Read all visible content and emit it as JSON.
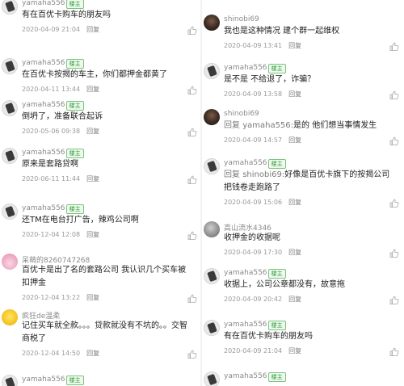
{
  "left": {
    "comments": [
      {
        "avatar": "yamaha",
        "name": "yamaha556",
        "badge": "楼主",
        "text": "有在百优卡购车的朋友吗",
        "time": "2020-04-09 21:04",
        "reply": "回复"
      },
      {
        "avatar": "yamaha",
        "name": "yamaha556",
        "badge": "楼主",
        "text": "在百优卡按揭的车主，你们都押金都黄了",
        "time": "2020-04-11 13:44",
        "reply": "回复"
      },
      {
        "avatar": "yamaha",
        "name": "yamaha556",
        "badge": "楼主",
        "text": "倒坍了，准备联合起诉",
        "time": "2020-05-06 09:38",
        "reply": "回复"
      },
      {
        "avatar": "yamaha",
        "name": "yamaha556",
        "badge": "楼主",
        "text": "原来是套路贷啊",
        "time": "2020-06-11 11:44",
        "reply": "回复"
      },
      {
        "avatar": "yamaha",
        "name": "yamaha556",
        "badge": "楼主",
        "text": "还TM在电台打广告，辣鸡公司啊",
        "time": "2020-12-04 12:08",
        "reply": "回复"
      },
      {
        "avatar": "bunny",
        "name": "呆萌的8260747268",
        "badge": "",
        "text": "百优卡是出了名的套路公司 我认识几个买车被扣押金",
        "time": "2020-12-04 13:22",
        "reply": "回复"
      },
      {
        "avatar": "jaune",
        "name": "疯狂de温柔",
        "badge": "",
        "text": "记住买车就全款。。。贷款就没有不坑的。。交智商税了",
        "time": "2020-12-04 14:50",
        "reply": "回复"
      },
      {
        "avatar": "yamaha",
        "name": "yamaha556",
        "badge": "楼主",
        "text": "",
        "time": "",
        "reply": ""
      }
    ]
  },
  "right": {
    "comments": [
      {
        "avatar": "shino",
        "name": "shinobi69",
        "badge": "",
        "text": "我也是这种情况 建个群一起维权",
        "time": "2020-04-09 13:41",
        "reply": "回复"
      },
      {
        "avatar": "yamaha",
        "name": "yamaha556",
        "badge": "楼主",
        "text": "是不是 不给退了，诈骗？",
        "time": "2020-04-09 13:58",
        "reply": "回复"
      },
      {
        "avatar": "shino",
        "name": "shinobi69",
        "badge": "",
        "text_prefix": "回复 ",
        "mention": "yamaha556:",
        "text": "是的 他们想当事情发生",
        "time": "2020-04-09 14:57",
        "reply": "回复"
      },
      {
        "avatar": "yamaha",
        "name": "yamaha556",
        "badge": "楼主",
        "text_prefix": "回复 ",
        "mention": "shinobi69:",
        "text": "好像是百优卡旗下的按揭公司把钱卷走跑路了",
        "time": "2020-04-09 15:06",
        "reply": "回复"
      },
      {
        "avatar": "gao",
        "name": "高山流水4346",
        "badge": "",
        "text": "收押金的收据呢",
        "time": "2020-04-09 17:30",
        "reply": "回复"
      },
      {
        "avatar": "yamaha",
        "name": "yamaha556",
        "badge": "楼主",
        "text": "收据上，公司公章都没有，故意拖",
        "time": "2020-04-09 20:42",
        "reply": "回复"
      },
      {
        "avatar": "yamaha",
        "name": "yamaha556",
        "badge": "楼主",
        "text": "有在百优卡购车的朋友吗",
        "time": "2020-04-09 21:04",
        "reply": "回复"
      },
      {
        "avatar": "yamaha",
        "name": "yamaha556",
        "badge": "楼主",
        "text": "",
        "time": "",
        "reply": ""
      }
    ]
  },
  "colors": {
    "badge_green": "#2f9a35",
    "name_gray": "#8a8a8a",
    "text": "#222222",
    "meta": "#9a9a9a"
  },
  "icons": {
    "like": "thumb-up-icon"
  }
}
